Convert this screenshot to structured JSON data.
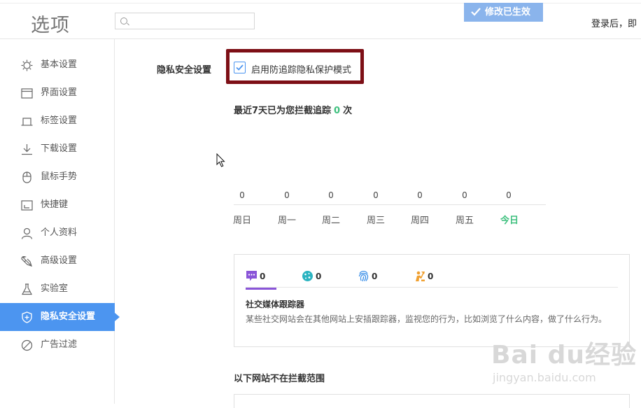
{
  "header": {
    "title": "选项",
    "search_placeholder": "",
    "saved_label": "修改已生效",
    "login_text": "登录后，即"
  },
  "sidebar": {
    "items": [
      {
        "label": "基本设置",
        "icon": "gear-icon"
      },
      {
        "label": "界面设置",
        "icon": "window-icon"
      },
      {
        "label": "标签设置",
        "icon": "tab-icon"
      },
      {
        "label": "下载设置",
        "icon": "download-icon"
      },
      {
        "label": "鼠标手势",
        "icon": "mouse-icon"
      },
      {
        "label": "快捷键",
        "icon": "keyboard-shortcut-icon"
      },
      {
        "label": "个人资料",
        "icon": "user-icon"
      },
      {
        "label": "高级设置",
        "icon": "wrench-icon"
      },
      {
        "label": "实验室",
        "icon": "flask-icon"
      },
      {
        "label": "隐私安全设置",
        "icon": "shield-icon",
        "active": true
      },
      {
        "label": "广告过滤",
        "icon": "block-icon"
      }
    ]
  },
  "privacy": {
    "section_label": "隐私安全设置",
    "checkbox_label": "启用防追踪隐私保护模式",
    "checkbox_checked": true,
    "stat_prefix": "最近7天已为您拦截追踪",
    "stat_count": "0",
    "stat_suffix": "次",
    "days": [
      {
        "name": "周日",
        "count": "0"
      },
      {
        "name": "周一",
        "count": "0"
      },
      {
        "name": "周二",
        "count": "0"
      },
      {
        "name": "周三",
        "count": "0"
      },
      {
        "name": "周四",
        "count": "0"
      },
      {
        "name": "周五",
        "count": "0"
      },
      {
        "name": "今日",
        "count": "0",
        "today": true
      }
    ],
    "tabs": [
      {
        "icon": "chat-icon",
        "count": "0",
        "color": "#8a55d8"
      },
      {
        "icon": "cookie-icon",
        "count": "0",
        "color": "#2ab3c0"
      },
      {
        "icon": "fingerprint-icon",
        "count": "0",
        "color": "#3a8fe8"
      },
      {
        "icon": "digging-icon",
        "count": "0",
        "color": "#f0a030"
      }
    ],
    "tracker_title": "社交媒体跟踪器",
    "tracker_desc": "某些社交网站会在其他网站上安插跟踪器，监视您的行为，比如浏览了什么内容，做了什么行为。",
    "exclusion_title": "以下网站不在拦截范围"
  },
  "watermark": {
    "main": "Bai du经验",
    "sub": "jingyan.baidu.com"
  },
  "colors": {
    "accent": "#4c95f0",
    "today_green": "#3ec07e",
    "highlight_border": "#7d0f16"
  }
}
